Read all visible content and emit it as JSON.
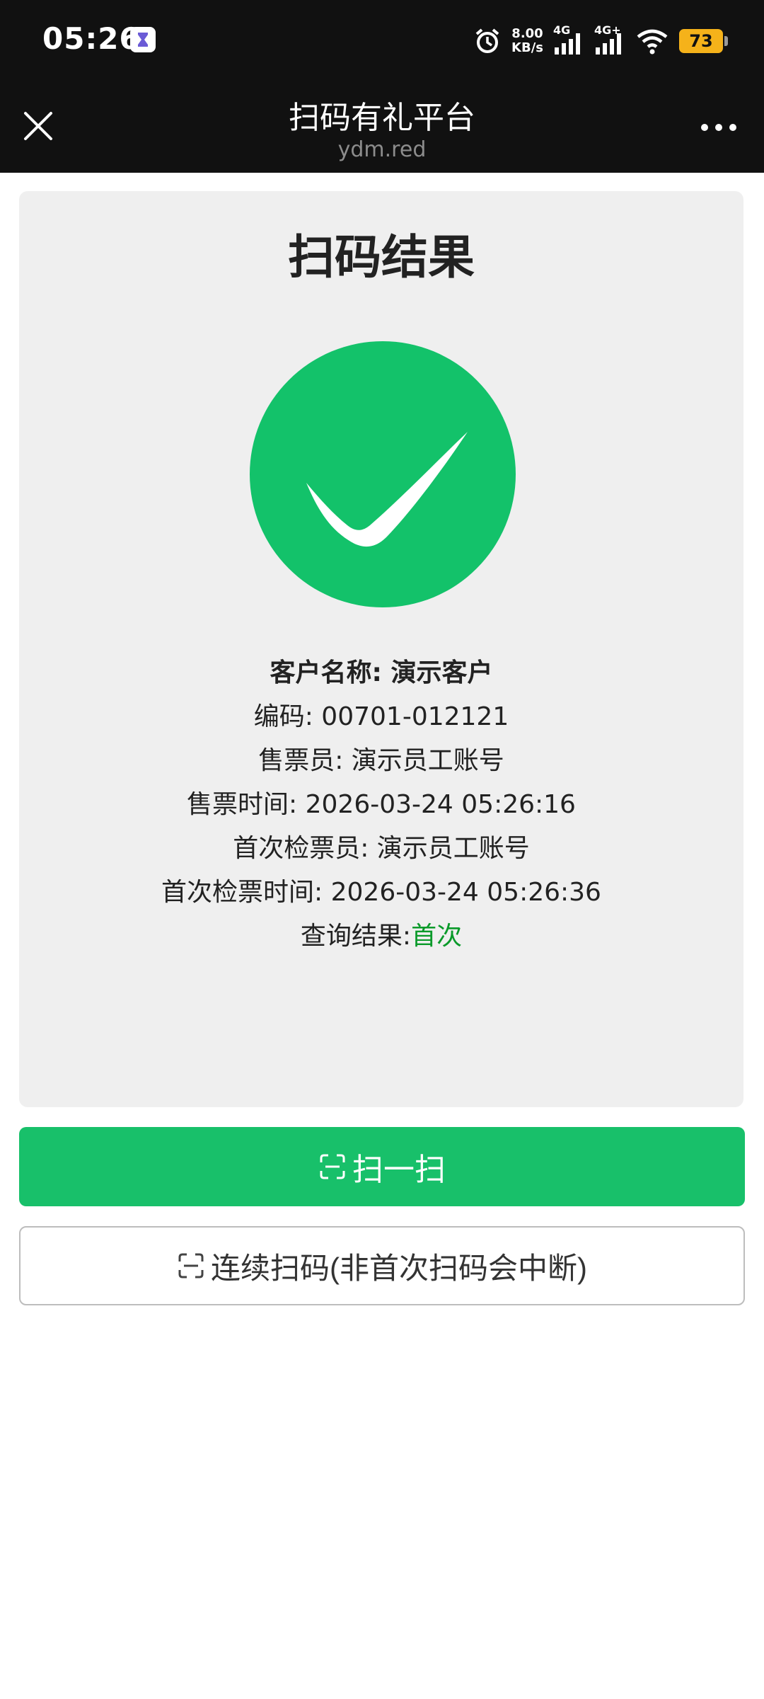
{
  "status_bar": {
    "time": "05:26",
    "speed_value": "8.00",
    "speed_unit": "KB/s",
    "sim1_tag": "4G",
    "sim2_tag": "4G+",
    "battery": "73"
  },
  "header": {
    "title": "扫码有礼平台",
    "subtitle": "ydm.red"
  },
  "card": {
    "title": "扫码结果",
    "customer_name": "客户名称: 演示客户",
    "code": "编码: 00701-012121",
    "seller": "售票员: 演示员工账号",
    "sell_time": "售票时间: 2026-03-24 05:26:16",
    "first_checker": "首次检票员: 演示员工账号",
    "first_check_time": "首次检票时间: 2026-03-24 05:26:36",
    "query_label": "查询结果:",
    "query_value": "首次"
  },
  "buttons": {
    "scan_label": "扫一扫",
    "continuous_label": "连续扫码(非首次扫码会中断)"
  },
  "colors": {
    "accent_green": "#18c06a",
    "result_green": "#0a9a2a",
    "battery_yellow": "#f5b21a"
  }
}
